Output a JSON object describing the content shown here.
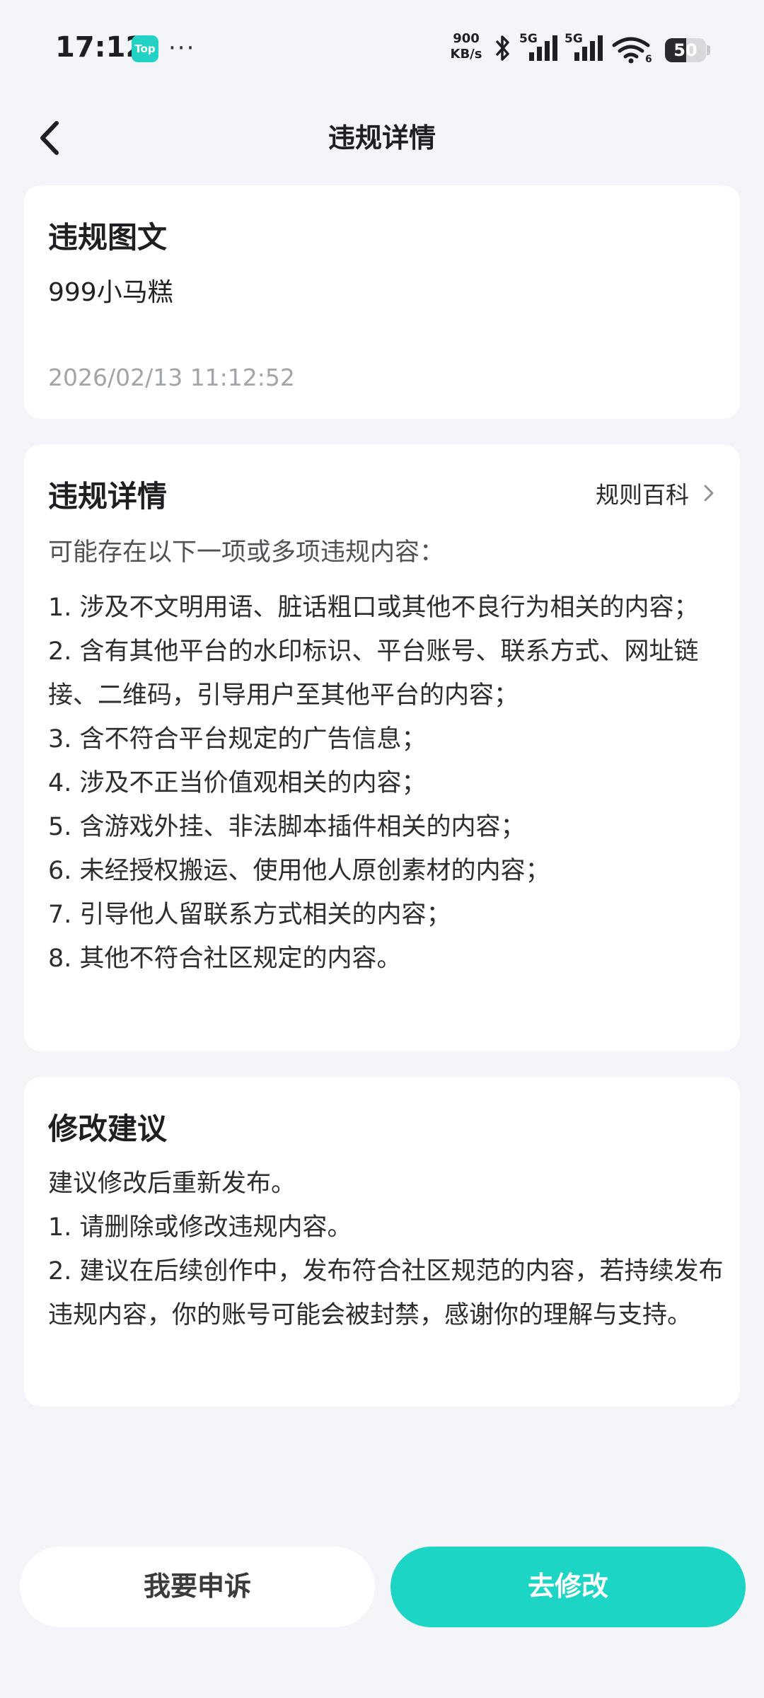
{
  "status_bar": {
    "time": "17:12",
    "app_badge": "Top",
    "more": "···",
    "net_speed_value": "900",
    "net_speed_unit": "KB/s",
    "sim1_label": "5G",
    "sim2_label": "5G",
    "wifi_label": "6",
    "battery_percent": "50"
  },
  "nav": {
    "title": "违规详情"
  },
  "content_card": {
    "title": "违规图文",
    "name": "999小马糕",
    "timestamp": "2026/02/13 11:12:52"
  },
  "violation_card": {
    "title": "违规详情",
    "rules_link": "规则百科",
    "intro": "可能存在以下一项或多项违规内容：",
    "items": [
      "1. 涉及不文明用语、脏话粗口或其他不良行为相关的内容；",
      "2. 含有其他平台的水印标识、平台账号、联系方式、网址链接、二维码，引导用户至其他平台的内容；",
      "3. 含不符合平台规定的广告信息；",
      "4. 涉及不正当价值观相关的内容；",
      "5. 含游戏外挂、非法脚本插件相关的内容；",
      "6. 未经授权搬运、使用他人原创素材的内容；",
      "7. 引导他人留联系方式相关的内容；",
      "8. 其他不符合社区规定的内容。"
    ]
  },
  "suggestion_card": {
    "title": "修改建议",
    "lines": [
      "建议修改后重新发布。",
      "1. 请删除或修改违规内容。",
      "2. 建议在后续创作中，发布符合社区规范的内容，若持续发布违规内容，你的账号可能会被封禁，感谢你的理解与支持。"
    ]
  },
  "actions": {
    "appeal_label": "我要申诉",
    "edit_label": "去修改"
  },
  "colors": {
    "accent": "#1DD5C4",
    "background": "#F3F5F8",
    "card": "#FFFFFF",
    "muted_text": "#A1A4A9"
  }
}
